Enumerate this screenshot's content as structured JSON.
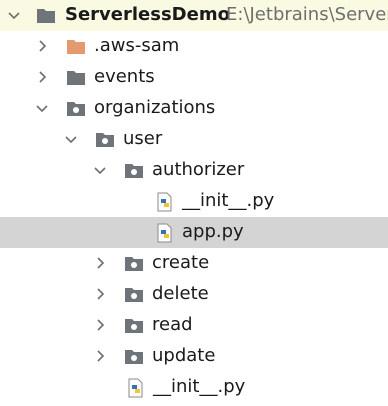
{
  "project": {
    "name": "ServerlessDemo",
    "path": "E:\\Jetbrains\\Server"
  },
  "tree": {
    "aws_sam": ".aws-sam",
    "events": "events",
    "organizations": "organizations",
    "user": "user",
    "authorizer": "authorizer",
    "authorizer_init": "__init__.py",
    "authorizer_app": "app.py",
    "create": "create",
    "delete": "delete",
    "read": "read",
    "update": "update",
    "user_init": "__init__.py"
  },
  "colors": {
    "root_row_bg": "#fafae3",
    "selected_row_bg": "#d4d4d4",
    "folder_gray": "#6f737a",
    "folder_excluded": "#e5996e",
    "python_blue": "#3872b4",
    "python_yellow": "#f2c337"
  },
  "icons": {
    "folder": "folder-icon",
    "excluded_folder": "excluded-folder-icon",
    "package": "package-folder-icon",
    "python_file": "python-file-icon",
    "expand": "chevron-right-icon",
    "collapse": "chevron-down-icon"
  }
}
